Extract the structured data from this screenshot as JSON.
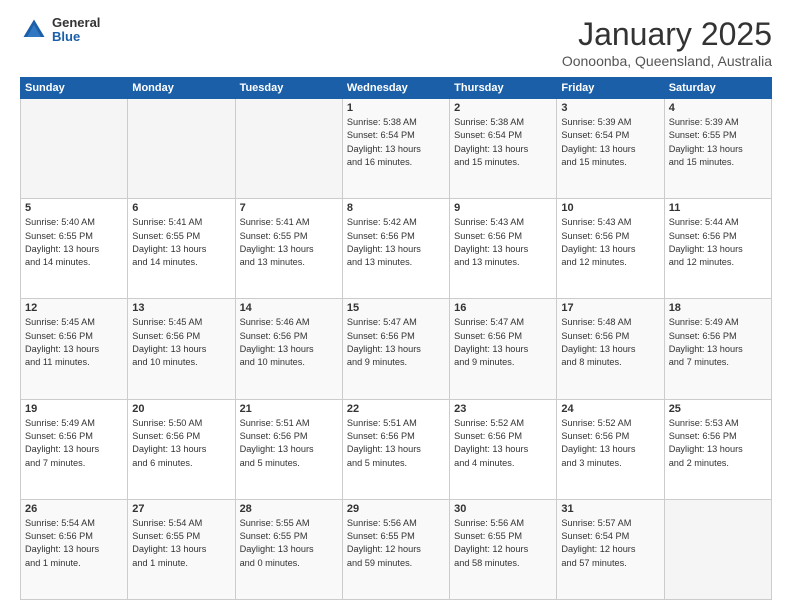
{
  "logo": {
    "general": "General",
    "blue": "Blue"
  },
  "header": {
    "title": "January 2025",
    "location": "Oonoonba, Queensland, Australia"
  },
  "weekdays": [
    "Sunday",
    "Monday",
    "Tuesday",
    "Wednesday",
    "Thursday",
    "Friday",
    "Saturday"
  ],
  "weeks": [
    [
      {
        "day": "",
        "info": ""
      },
      {
        "day": "",
        "info": ""
      },
      {
        "day": "",
        "info": ""
      },
      {
        "day": "1",
        "info": "Sunrise: 5:38 AM\nSunset: 6:54 PM\nDaylight: 13 hours\nand 16 minutes."
      },
      {
        "day": "2",
        "info": "Sunrise: 5:38 AM\nSunset: 6:54 PM\nDaylight: 13 hours\nand 15 minutes."
      },
      {
        "day": "3",
        "info": "Sunrise: 5:39 AM\nSunset: 6:54 PM\nDaylight: 13 hours\nand 15 minutes."
      },
      {
        "day": "4",
        "info": "Sunrise: 5:39 AM\nSunset: 6:55 PM\nDaylight: 13 hours\nand 15 minutes."
      }
    ],
    [
      {
        "day": "5",
        "info": "Sunrise: 5:40 AM\nSunset: 6:55 PM\nDaylight: 13 hours\nand 14 minutes."
      },
      {
        "day": "6",
        "info": "Sunrise: 5:41 AM\nSunset: 6:55 PM\nDaylight: 13 hours\nand 14 minutes."
      },
      {
        "day": "7",
        "info": "Sunrise: 5:41 AM\nSunset: 6:55 PM\nDaylight: 13 hours\nand 13 minutes."
      },
      {
        "day": "8",
        "info": "Sunrise: 5:42 AM\nSunset: 6:56 PM\nDaylight: 13 hours\nand 13 minutes."
      },
      {
        "day": "9",
        "info": "Sunrise: 5:43 AM\nSunset: 6:56 PM\nDaylight: 13 hours\nand 13 minutes."
      },
      {
        "day": "10",
        "info": "Sunrise: 5:43 AM\nSunset: 6:56 PM\nDaylight: 13 hours\nand 12 minutes."
      },
      {
        "day": "11",
        "info": "Sunrise: 5:44 AM\nSunset: 6:56 PM\nDaylight: 13 hours\nand 12 minutes."
      }
    ],
    [
      {
        "day": "12",
        "info": "Sunrise: 5:45 AM\nSunset: 6:56 PM\nDaylight: 13 hours\nand 11 minutes."
      },
      {
        "day": "13",
        "info": "Sunrise: 5:45 AM\nSunset: 6:56 PM\nDaylight: 13 hours\nand 10 minutes."
      },
      {
        "day": "14",
        "info": "Sunrise: 5:46 AM\nSunset: 6:56 PM\nDaylight: 13 hours\nand 10 minutes."
      },
      {
        "day": "15",
        "info": "Sunrise: 5:47 AM\nSunset: 6:56 PM\nDaylight: 13 hours\nand 9 minutes."
      },
      {
        "day": "16",
        "info": "Sunrise: 5:47 AM\nSunset: 6:56 PM\nDaylight: 13 hours\nand 9 minutes."
      },
      {
        "day": "17",
        "info": "Sunrise: 5:48 AM\nSunset: 6:56 PM\nDaylight: 13 hours\nand 8 minutes."
      },
      {
        "day": "18",
        "info": "Sunrise: 5:49 AM\nSunset: 6:56 PM\nDaylight: 13 hours\nand 7 minutes."
      }
    ],
    [
      {
        "day": "19",
        "info": "Sunrise: 5:49 AM\nSunset: 6:56 PM\nDaylight: 13 hours\nand 7 minutes."
      },
      {
        "day": "20",
        "info": "Sunrise: 5:50 AM\nSunset: 6:56 PM\nDaylight: 13 hours\nand 6 minutes."
      },
      {
        "day": "21",
        "info": "Sunrise: 5:51 AM\nSunset: 6:56 PM\nDaylight: 13 hours\nand 5 minutes."
      },
      {
        "day": "22",
        "info": "Sunrise: 5:51 AM\nSunset: 6:56 PM\nDaylight: 13 hours\nand 5 minutes."
      },
      {
        "day": "23",
        "info": "Sunrise: 5:52 AM\nSunset: 6:56 PM\nDaylight: 13 hours\nand 4 minutes."
      },
      {
        "day": "24",
        "info": "Sunrise: 5:52 AM\nSunset: 6:56 PM\nDaylight: 13 hours\nand 3 minutes."
      },
      {
        "day": "25",
        "info": "Sunrise: 5:53 AM\nSunset: 6:56 PM\nDaylight: 13 hours\nand 2 minutes."
      }
    ],
    [
      {
        "day": "26",
        "info": "Sunrise: 5:54 AM\nSunset: 6:56 PM\nDaylight: 13 hours\nand 1 minute."
      },
      {
        "day": "27",
        "info": "Sunrise: 5:54 AM\nSunset: 6:55 PM\nDaylight: 13 hours\nand 1 minute."
      },
      {
        "day": "28",
        "info": "Sunrise: 5:55 AM\nSunset: 6:55 PM\nDaylight: 13 hours\nand 0 minutes."
      },
      {
        "day": "29",
        "info": "Sunrise: 5:56 AM\nSunset: 6:55 PM\nDaylight: 12 hours\nand 59 minutes."
      },
      {
        "day": "30",
        "info": "Sunrise: 5:56 AM\nSunset: 6:55 PM\nDaylight: 12 hours\nand 58 minutes."
      },
      {
        "day": "31",
        "info": "Sunrise: 5:57 AM\nSunset: 6:54 PM\nDaylight: 12 hours\nand 57 minutes."
      },
      {
        "day": "",
        "info": ""
      }
    ]
  ]
}
